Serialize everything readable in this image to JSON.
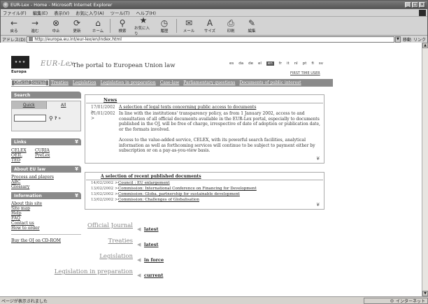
{
  "window": {
    "title": "EUR-Lex - Home - Microsoft Internet Explorer",
    "buttons": [
      "_",
      "□",
      "×"
    ]
  },
  "menu": [
    "ファイル(F)",
    "編集(E)",
    "表示(V)",
    "お気に入り(A)",
    "ツール(T)",
    "ヘルプ(H)"
  ],
  "toolbar": [
    {
      "label": "戻る",
      "icon": "←"
    },
    {
      "label": "進む",
      "icon": "→"
    },
    {
      "label": "中止",
      "icon": "⊗"
    },
    {
      "label": "更新",
      "icon": "⟳"
    },
    {
      "label": "ホーム",
      "icon": "⌂"
    },
    {
      "label": "検索",
      "icon": "⚲"
    },
    {
      "label": "お気に入り",
      "icon": "★"
    },
    {
      "label": "履歴",
      "icon": "◷"
    },
    {
      "label": "メール",
      "icon": "✉"
    },
    {
      "label": "サイズ",
      "icon": "A"
    },
    {
      "label": "印刷",
      "icon": "⎙"
    },
    {
      "label": "編集",
      "icon": "✎"
    }
  ],
  "address": {
    "label": "アドレス(D)",
    "url": "http://europa.eu.int/eur-lex/en/index.html",
    "go": "移動",
    "links": "リンク"
  },
  "header": {
    "flag_text": "★★★",
    "europa": "Europa",
    "logo": "EUR-Lex",
    "tagline": "- The portal to European Union law",
    "languages": [
      "es",
      "da",
      "de",
      "el",
      "en",
      "fr",
      "it",
      "nl",
      "pt",
      "fi",
      "sv"
    ],
    "selected_language": "en",
    "first_time": "FIRST TIME USER"
  },
  "nav": [
    "Official Journal",
    "Treaties",
    "Legislation",
    "Legislation in preparation",
    "Case-law",
    "Parliamentary questions",
    "Documents of public interest"
  ],
  "sidebar": {
    "search": {
      "heading": "Search",
      "tab_quick": "Quick",
      "tab_all": "All",
      "help": "?",
      "more": "»"
    },
    "links": {
      "heading": "Links",
      "items": [
        "CELEX",
        "CURIA",
        "OEIL",
        "PreLex",
        "TED"
      ]
    },
    "about": {
      "heading": "About EU law",
      "items": [
        "Process and players",
        "ABC",
        "Glossary"
      ]
    },
    "information": {
      "heading": "Information",
      "items": [
        "About this site",
        "Site map",
        "Help",
        "FAQ",
        "Contact us",
        "How to order"
      ]
    },
    "buy": "Buy the OJ on CD-ROM"
  },
  "news": {
    "title": "News",
    "items": [
      {
        "date": "17/01/2002 >",
        "text": "A selection of legal texts concerning public access to documents",
        "link": true
      },
      {
        "date": "01/01/2002 >",
        "text": "In line with the institutions' transparency policy, as from 1 January 2002, access to and consultation of all official documents available in the EUR-Lex portal, especially to documents published in the OJ, will be free of charge, irrespective of date of adoption or publication date, or the formats involved.",
        "link": false
      },
      {
        "date": "",
        "text": "Access to the value-added service, CELEX, with its powerful search facilities, analytical information as well as forthcoming services will continue to be subject to payment either by subscription or on a pay-as-you-view basis.",
        "link": false
      }
    ]
  },
  "recent": {
    "title": "A selection of recent published documents",
    "items": [
      {
        "date": "14/02/2002 >",
        "text": "Council : EU enlargement"
      },
      {
        "date": "13/02/2002 >",
        "text": "Commission: International Conference on Financing for Development"
      },
      {
        "date": "13/02/2002 >",
        "text": "Commission: Globa. partnership for sustainable development"
      },
      {
        "date": "13/02/2002 >",
        "text": "Commission: Challenges of Globalisation"
      }
    ]
  },
  "bottom_links": [
    {
      "label": "Official Journal",
      "action": "latest"
    },
    {
      "label": "Treaties",
      "action": "latest"
    },
    {
      "label": "Legislation",
      "action": "in force"
    },
    {
      "label": "Legislation in preparation",
      "action": "current"
    }
  ],
  "status": {
    "text": "ページが表示されました",
    "zone": "インターネット"
  }
}
